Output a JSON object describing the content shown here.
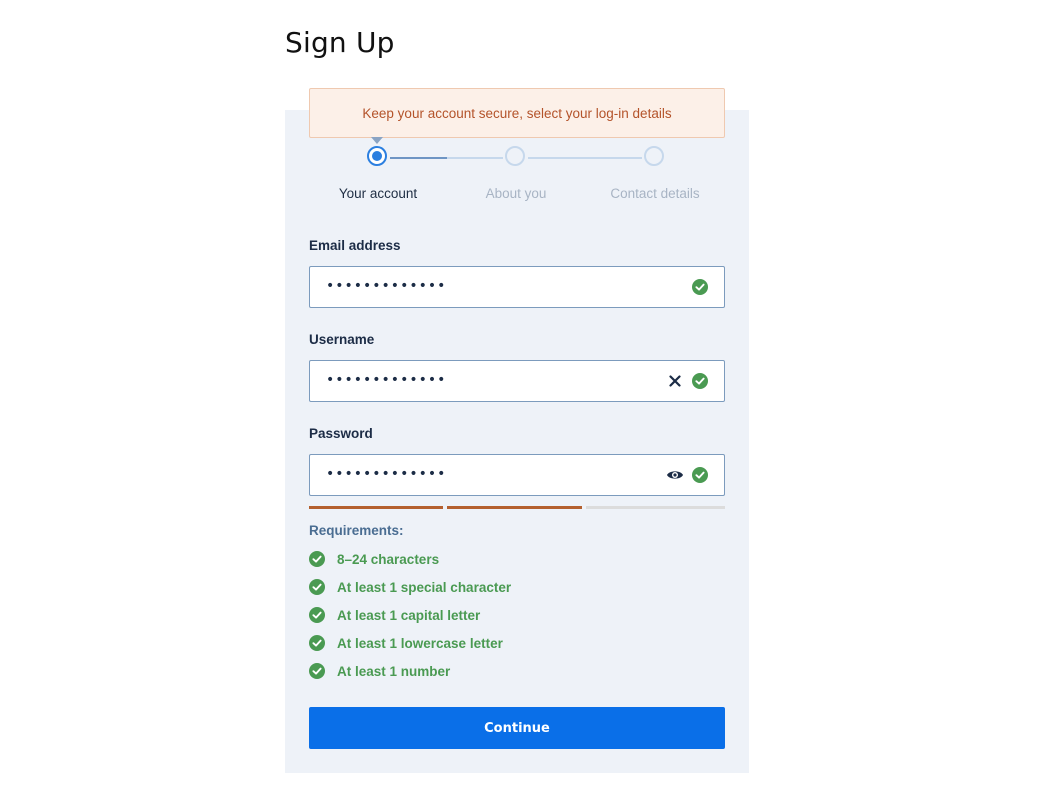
{
  "page": {
    "title": "Sign Up"
  },
  "banner": {
    "text": "Keep your account secure, select your log-in details"
  },
  "stepper": {
    "steps": [
      {
        "label": "Your account",
        "state": "active"
      },
      {
        "label": "About you",
        "state": "inactive"
      },
      {
        "label": "Contact details",
        "state": "inactive"
      }
    ]
  },
  "form": {
    "email": {
      "label": "Email address",
      "value": "•••••••••••••",
      "valid": true
    },
    "username": {
      "label": "Username",
      "value": "•••••••••••••",
      "valid": true
    },
    "password": {
      "label": "Password",
      "value": "•••••••••••••",
      "valid": true,
      "strength_segments_filled": 2,
      "strength_segments_total": 3
    }
  },
  "requirements": {
    "title": "Requirements:",
    "items": [
      {
        "text": "8–24 characters",
        "met": true
      },
      {
        "text": "At least 1 special character",
        "met": true
      },
      {
        "text": "At least 1 capital letter",
        "met": true
      },
      {
        "text": "At least 1 lowercase letter",
        "met": true
      },
      {
        "text": "At least 1 number",
        "met": true
      }
    ]
  },
  "actions": {
    "continue_label": "Continue"
  },
  "colors": {
    "accent": "#0a6fe8",
    "success": "#4a9a52",
    "warning_text": "#b4532a",
    "strength": "#b4602f",
    "card_background": "#eef2f8"
  },
  "icons": {
    "valid": "check-circle-icon",
    "clear": "close-icon",
    "reveal": "eye-icon"
  }
}
